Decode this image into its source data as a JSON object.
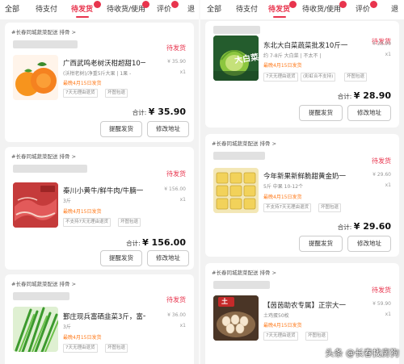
{
  "left": {
    "tabs": [
      "全部",
      "待支付",
      "待发货",
      "待收货/使用",
      "评价",
      "退"
    ],
    "active_tab": "待发货",
    "orders": [
      {
        "store": "#长春同城蔬菜配送 排骨 >",
        "status": "待发货",
        "title": "广西武鸣老树沃柑超甜10一",
        "spec": "(沃柑老树)/净重5斤大果 | 1果 -",
        "price": "¥ 35.90",
        "qty": "x1",
        "ship": "最晚4月15日发货",
        "tags": [
          "7天无理由退货",
          "坏图包退"
        ],
        "total_label": "合计:",
        "total_value": "¥ 35.90",
        "buttons": [
          "提醒发货",
          "修改地址"
        ]
      },
      {
        "store": "#长春同城蔬菜配送 排骨 >",
        "status": "待发货",
        "title": "秦川小黄牛/鲜牛肉/牛腩一",
        "spec": "3斤",
        "price": "¥ 156.00",
        "qty": "x1",
        "ship": "最晚4月15日发货",
        "tags": [
          "不支持7天无理由退货",
          "坏图包退"
        ],
        "total_label": "合计:",
        "total_value": "¥ 156.00",
        "buttons": [
          "提醒发货",
          "修改地址"
        ]
      },
      {
        "store": "#长春同城蔬菜配送 排骨 >",
        "status": "待发货",
        "title": "鄞庄现兵富硒韭菜3斤，富一",
        "spec": "3斤",
        "price": "¥ 36.00",
        "qty": "x1",
        "ship": "最晚4月15日发货",
        "tags": [
          "7天无理由退货",
          "坏图包退"
        ]
      }
    ]
  },
  "right": {
    "tabs": [
      "全部",
      "待支付",
      "待发货",
      "待收货/使用",
      "评价",
      "退"
    ],
    "active_tab": "待发货",
    "orders": [
      {
        "status": "待发货",
        "title": "东北大白菜蔬菜批发10斤一",
        "spec": "约 7-8斤 大白菜 | 不太不 |",
        "price": "¥ 28.90",
        "qty": "x1",
        "ship": "最晚4月15日发货",
        "tags": [
          "7天无理由退货",
          "(彩虹合不支持)",
          "坏图包退"
        ],
        "total_label": "合计:",
        "total_value": "¥ 28.90",
        "buttons": [
          "提醒发货",
          "修改地址"
        ],
        "thumb_text": "大白菜"
      },
      {
        "store": "#长春同城蔬菜配送 排骨 >",
        "status": "待发货",
        "title": "今年新果新鲜脆甜黄金奶一",
        "spec": "5斤 中果 10-12个",
        "price": "¥ 29.60",
        "qty": "x1",
        "ship": "最晚4月15日发货",
        "tags": [
          "不支持7天无理由退货",
          "坏图包退"
        ],
        "total_label": "合计:",
        "total_value": "¥ 29.60",
        "buttons": [
          "提醒发货",
          "修改地址"
        ]
      },
      {
        "store": "#长春同城蔬菜配送 排骨 >",
        "status": "待发货",
        "title": "【茵茵助农专属】正宗大一",
        "spec": "土鸡蛋50枚",
        "price": "¥ 59.90",
        "qty": "x1",
        "ship": "最晚4月15日发货",
        "tags": [
          "7天无理由退货",
          "坏图包退"
        ],
        "thumb_text": "土"
      }
    ],
    "watermark": "头条 @长春找房狗"
  }
}
